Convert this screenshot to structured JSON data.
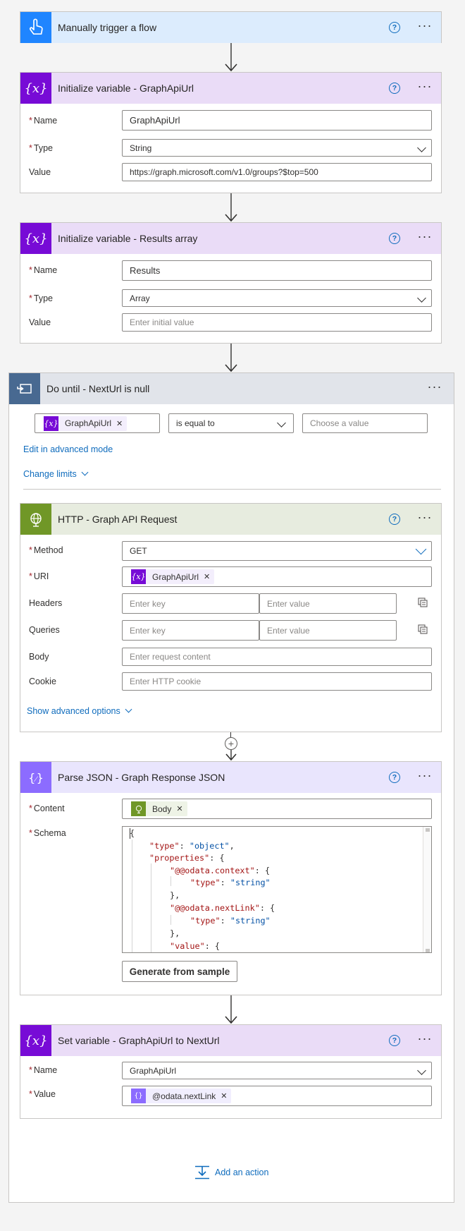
{
  "trigger": {
    "title": "Manually trigger a flow",
    "help_icon": "question-circle-icon",
    "more_label": "···"
  },
  "init_url": {
    "title": "Initialize variable - GraphApiUrl",
    "name_label": "Name",
    "name_value": "GraphApiUrl",
    "type_label": "Type",
    "type_value": "String",
    "value_label": "Value",
    "value_value": "https://graph.microsoft.com/v1.0/groups?$top=500"
  },
  "init_results": {
    "title": "Initialize variable - Results array",
    "name_label": "Name",
    "name_value": "Results",
    "type_label": "Type",
    "type_value": "Array",
    "value_label": "Value",
    "value_placeholder": "Enter initial value"
  },
  "loop": {
    "title": "Do until - NextUrl is null",
    "condition_token": "GraphApiUrl",
    "operator": "is equal to",
    "value_placeholder": "Choose a value",
    "advanced_link": "Edit in advanced mode",
    "limits_link": "Change limits"
  },
  "http": {
    "title": "HTTP - Graph API Request",
    "method_label": "Method",
    "method_value": "GET",
    "uri_label": "URI",
    "uri_token": "GraphApiUrl",
    "headers_label": "Headers",
    "queries_label": "Queries",
    "key_placeholder": "Enter key",
    "value_placeholder": "Enter value",
    "body_label": "Body",
    "body_placeholder": "Enter request content",
    "cookie_label": "Cookie",
    "cookie_placeholder": "Enter HTTP cookie",
    "advanced_link": "Show advanced options"
  },
  "parse": {
    "title": "Parse JSON - Graph Response JSON",
    "content_label": "Content",
    "content_token": "Body",
    "schema_label": "Schema",
    "schema_lines": {
      "l0": "{",
      "l1k": "\"type\"",
      "l1v": "\"object\"",
      "l2k": "\"properties\"",
      "l3k": "\"@@odata.context\"",
      "l4k": "\"type\"",
      "l4v": "\"string\"",
      "l5": "},",
      "l6k": "\"@@odata.nextLink\"",
      "l7k": "\"type\"",
      "l7v": "\"string\"",
      "l8": "},",
      "l9k": "\"value\""
    },
    "generate_button": "Generate from sample"
  },
  "setvar": {
    "title": "Set variable - GraphApiUrl to NextUrl",
    "name_label": "Name",
    "name_value": "GraphApiUrl",
    "value_label": "Value",
    "value_token": "@odata.nextLink"
  },
  "add_action": "Add an action",
  "colors": {
    "trigger": "#1f85ff",
    "variable": "#770bd6",
    "loop": "#486991",
    "http": "#709727",
    "parse_json": "#8c6cff",
    "link": "#0f6cbd",
    "required": "#a4262c"
  }
}
